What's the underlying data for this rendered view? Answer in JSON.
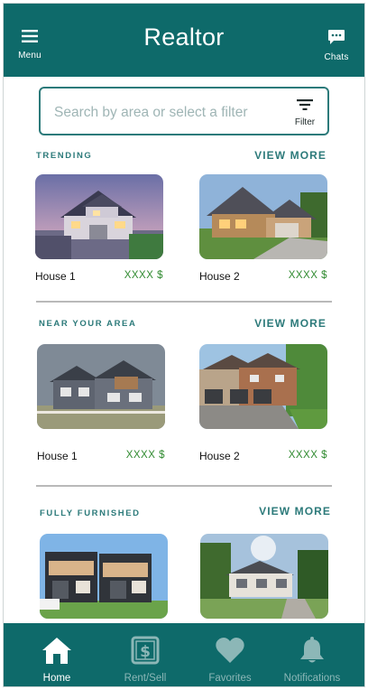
{
  "header": {
    "title": "Realtor",
    "menu_label": "Menu",
    "chats_label": "Chats"
  },
  "search": {
    "placeholder": "Search by area or select a filter",
    "filter_label": "Filter"
  },
  "sections": [
    {
      "title": "TRENDING",
      "view_more": "VIEW MORE",
      "listings": [
        {
          "name": "House 1",
          "price": "XXXX $"
        },
        {
          "name": "House 2",
          "price": "XXXX $"
        }
      ]
    },
    {
      "title": "NEAR YOUR AREA",
      "view_more": "VIEW MORE",
      "listings": [
        {
          "name": "House 1",
          "price": "XXXX $"
        },
        {
          "name": "House 2",
          "price": "XXXX $"
        }
      ]
    },
    {
      "title": "FULLY FURNISHED",
      "view_more": "VIEW MORE",
      "listings": [
        {
          "name": "",
          "price": ""
        },
        {
          "name": "",
          "price": ""
        }
      ]
    }
  ],
  "bottom_nav": {
    "items": [
      {
        "label": "Home",
        "icon": "home-icon",
        "active": true
      },
      {
        "label": "Rent/Sell",
        "icon": "dollar-sign-icon",
        "active": false
      },
      {
        "label": "Favorites",
        "icon": "heart-icon",
        "active": false
      },
      {
        "label": "Notifications",
        "icon": "bell-icon",
        "active": false
      }
    ]
  },
  "colors": {
    "primary": "#0e6a6a",
    "accent_text": "#2c7a7a",
    "price": "#2f8a2f",
    "nav_active": "#ffffff",
    "nav_inactive": "#8cb7b7"
  }
}
